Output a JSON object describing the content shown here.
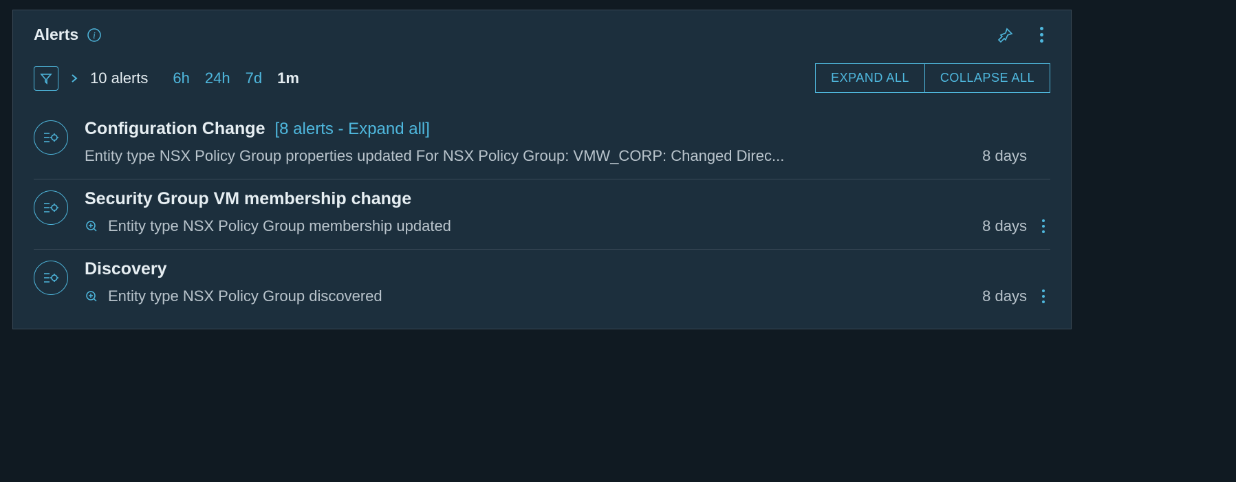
{
  "header": {
    "title": "Alerts"
  },
  "toolbar": {
    "count_label": "10 alerts",
    "ranges": {
      "r6h": "6h",
      "r24h": "24h",
      "r7d": "7d",
      "r1m": "1m"
    },
    "active_range": "1m",
    "expand_all": "EXPAND ALL",
    "collapse_all": "COLLAPSE ALL"
  },
  "groups": [
    {
      "title": "Configuration Change",
      "sublink": "[8 alerts - Expand all]",
      "has_sublink": true,
      "alert_has_zoom": false,
      "alert_has_kebab": false,
      "alert_text": "Entity type NSX Policy Group properties updated For NSX Policy Group: VMW_CORP: Changed Direc...",
      "alert_age": "8 days"
    },
    {
      "title": "Security Group VM membership change",
      "sublink": "",
      "has_sublink": false,
      "alert_has_zoom": true,
      "alert_has_kebab": true,
      "alert_text": "Entity type NSX Policy Group membership updated",
      "alert_age": "8 days"
    },
    {
      "title": "Discovery",
      "sublink": "",
      "has_sublink": false,
      "alert_has_zoom": true,
      "alert_has_kebab": true,
      "alert_text": "Entity type NSX Policy Group discovered",
      "alert_age": "8 days"
    }
  ],
  "icons": {
    "info": "info-icon",
    "pin": "pin-icon",
    "kebab": "kebab-icon",
    "filter": "filter-icon",
    "chevron_right": "chevron-right-icon",
    "settings_list": "settings-list-icon",
    "zoom_plus": "zoom-plus-icon"
  }
}
